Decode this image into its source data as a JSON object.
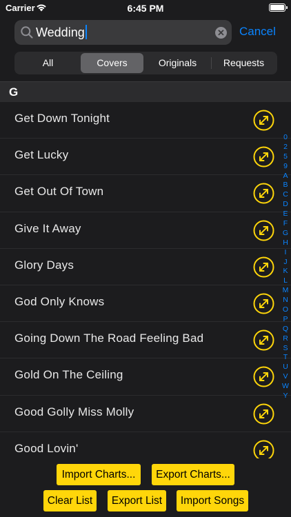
{
  "status_bar": {
    "carrier": "Carrier",
    "time": "6:45 PM"
  },
  "search": {
    "value": "Wedding",
    "cancel_label": "Cancel"
  },
  "segments": [
    "All",
    "Covers",
    "Originals",
    "Requests"
  ],
  "selected_segment": "Covers",
  "section": {
    "letter": "G"
  },
  "songs": [
    "Get Down Tonight",
    "Get Lucky",
    "Get Out Of Town",
    "Give It Away",
    "Glory Days",
    "God Only Knows",
    "Going Down The Road Feeling Bad",
    "Gold On The Ceiling",
    "Good Golly Miss Molly",
    "Good Lovin'"
  ],
  "index_letters": [
    "0",
    "2",
    "5",
    "9",
    "A",
    "B",
    "C",
    "D",
    "E",
    "F",
    "G",
    "H",
    "I",
    "J",
    "K",
    "L",
    "M",
    "N",
    "O",
    "P",
    "Q",
    "R",
    "S",
    "T",
    "U",
    "V",
    "W",
    "Y"
  ],
  "buttons": {
    "import_charts": "Import Charts...",
    "export_charts": "Export Charts...",
    "clear_list": "Clear List",
    "export_list": "Export List",
    "import_songs": "Import Songs"
  },
  "colors": {
    "accent": "#0a84ff",
    "yellow": "#ffd60a",
    "background": "#1c1c1e"
  },
  "icons": {
    "row_action": "expand-arrows-icon"
  }
}
